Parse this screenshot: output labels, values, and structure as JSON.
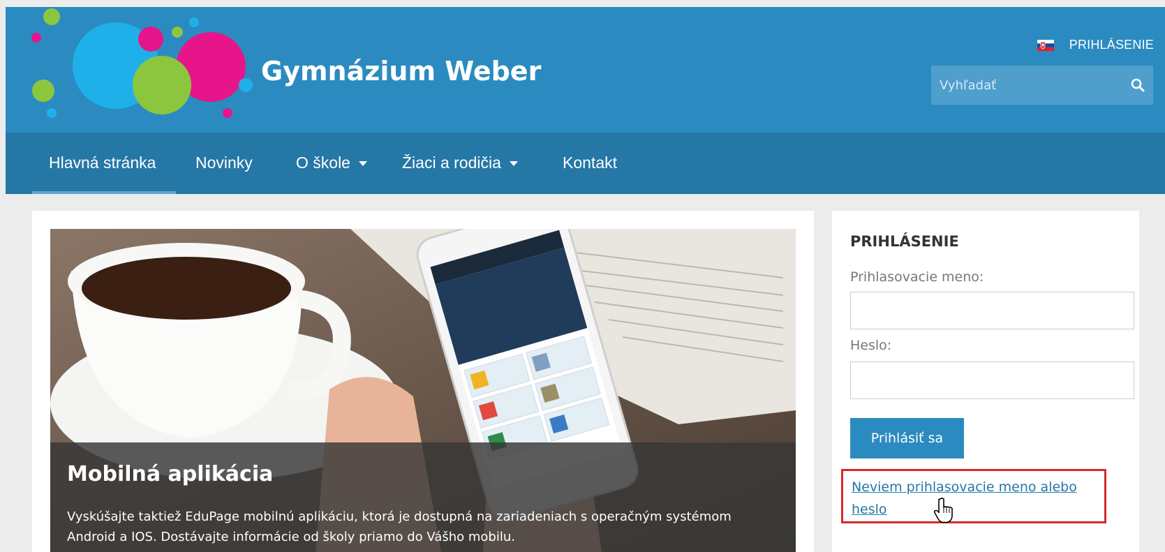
{
  "header": {
    "site_title": "Gymnázium Weber",
    "login_link": "PRIHLÁSENIE",
    "flag_icon": "slovakia-flag-icon",
    "search": {
      "placeholder": "Vyhľadať",
      "icon": "search-icon"
    },
    "background_color": "#2b8bc0"
  },
  "nav": {
    "items": [
      {
        "label": "Hlavná stránka",
        "active": true,
        "dropdown": false
      },
      {
        "label": "Novinky",
        "active": false,
        "dropdown": false
      },
      {
        "label": "O škole",
        "active": false,
        "dropdown": true
      },
      {
        "label": "Žiaci a rodičia",
        "active": false,
        "dropdown": true
      },
      {
        "label": "Kontakt",
        "active": false,
        "dropdown": false
      }
    ],
    "background_color": "#2577a6"
  },
  "hero": {
    "title": "Mobilná aplikácia",
    "text": "Vyskúšajte taktiež EduPage mobilnú aplikáciu, ktorá je dostupná na zariadeniach s operačným systémom Android a IOS. Dostávajte informácie od školy priamo do Vášho mobilu."
  },
  "login": {
    "heading": "PRIHLÁSENIE",
    "username_label": "Prihlasovacie meno:",
    "username_value": "",
    "password_label": "Heslo:",
    "password_value": "",
    "submit_label": "Prihlásiť sa",
    "forgot_link": "Neviem prihlasovacie meno alebo heslo",
    "highlight_color": "#d42b2f"
  }
}
